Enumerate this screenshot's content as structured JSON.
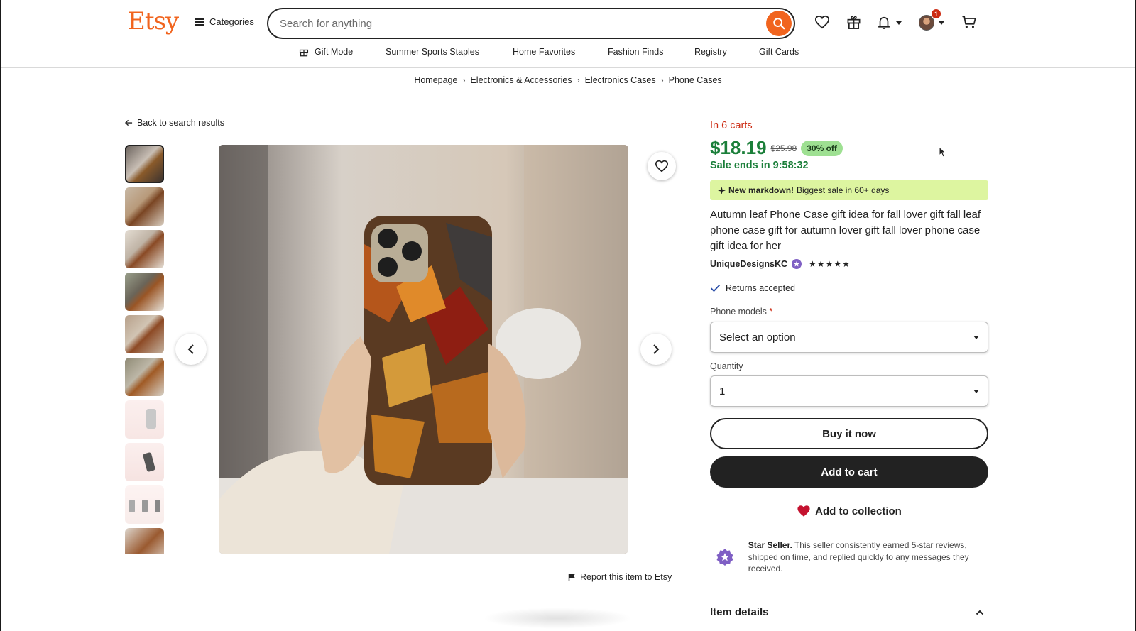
{
  "header": {
    "logo": "Etsy",
    "categories_label": "Categories",
    "search_placeholder": "Search for anything",
    "notification_count": "1",
    "accent_color": "#F1641E"
  },
  "subnav": {
    "items": [
      "Gift Mode",
      "Summer Sports Staples",
      "Home Favorites",
      "Fashion Finds",
      "Registry",
      "Gift Cards"
    ]
  },
  "breadcrumb": {
    "items": [
      "Homepage",
      "Electronics & Accessories",
      "Electronics Cases",
      "Phone Cases"
    ]
  },
  "back_label": "Back to search results",
  "gallery": {
    "thumbnail_count": 10,
    "active_index": 0
  },
  "report_label": "Report this item to Etsy",
  "product": {
    "in_carts": "In 6 carts",
    "price": "$18.19",
    "original_price": "$25.98",
    "discount": "30% off",
    "sale_ends": "Sale ends in 9:58:32",
    "markdown_bold": "New markdown!",
    "markdown_text": "Biggest sale in 60+ days",
    "title": "Autumn leaf Phone Case gift idea for fall lover gift fall leaf phone case gift for autumn lover gift fall lover phone case gift idea for her",
    "shop_name": "UniqueDesignsKC",
    "rating_stars": "★★★★★",
    "returns": "Returns accepted",
    "phone_models_label": "Phone models",
    "required_mark": "*",
    "phone_models_value": "Select an option",
    "quantity_label": "Quantity",
    "quantity_value": "1",
    "buy_now": "Buy it now",
    "add_to_cart": "Add to cart",
    "add_to_collection": "Add to collection",
    "star_seller_bold": "Star Seller.",
    "star_seller_text": "This seller consistently earned 5-star reviews, shipped on time, and replied quickly to any messages they received.",
    "item_details": "Item details"
  }
}
